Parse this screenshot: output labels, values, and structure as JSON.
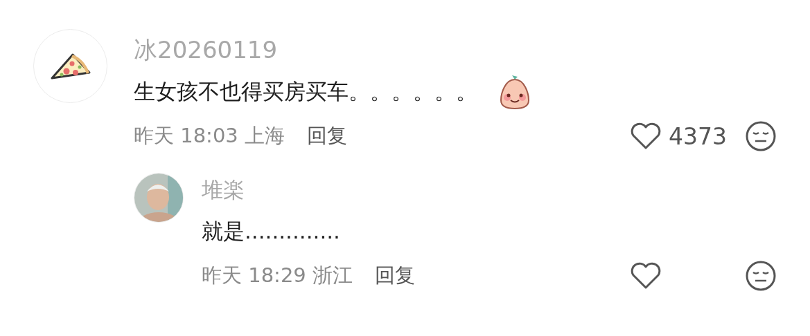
{
  "comments": [
    {
      "author": "冰20260119",
      "text": "生女孩不也得买房买车。。。。。。",
      "emoji": true,
      "time": "昨天 18:03 上海",
      "reply": "回复",
      "likes": "4373",
      "replies": [
        {
          "author": "堆楽",
          "text": "就是..............",
          "emoji": false,
          "time": "昨天 18:29 浙江",
          "reply": "回复"
        }
      ]
    }
  ]
}
